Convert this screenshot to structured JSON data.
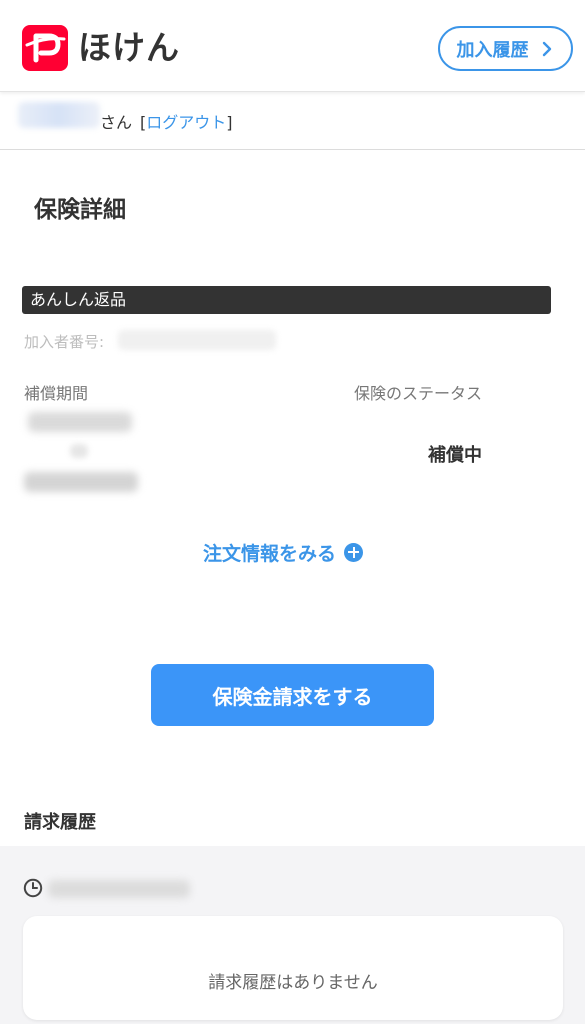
{
  "header": {
    "logo_text": "ほけん",
    "history_button_label": "加入履歴",
    "brand_color": "#ff0033",
    "accent_color": "#3b95e8"
  },
  "user": {
    "suffix": "さん",
    "logout_prefix": "[",
    "logout_label": "ログアウト",
    "logout_suffix": "]"
  },
  "page": {
    "title": "保険詳細"
  },
  "policy": {
    "product_name": "あんしん返品",
    "member_number_label": "加入者番号:",
    "coverage_period_label": "補償期間",
    "status_label": "保険のステータス",
    "status_value": "補償中"
  },
  "actions": {
    "order_info_link": "注文情報をみる",
    "claim_button": "保険金請求をする"
  },
  "claims": {
    "section_title": "請求履歴",
    "empty_message": "請求履歴はありません"
  },
  "icons": {
    "logo": "paypay-p-logo-icon",
    "history_chevron": "chevron-right-icon",
    "order_expand": "plus-circle-icon",
    "claims_time": "clock-icon"
  }
}
